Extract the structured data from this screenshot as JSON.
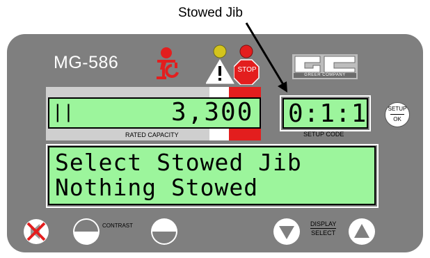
{
  "callout": {
    "label": "Stowed Jib"
  },
  "device": {
    "model": "MG-586",
    "logo_text": "GREER COMPANY",
    "stop_label": "STOP"
  },
  "rated_capacity": {
    "value": "3,300",
    "label": "RATED CAPACITY",
    "bar_indicator": "||"
  },
  "setup_code": {
    "value": "0:1:1",
    "label": "SETUP CODE"
  },
  "main_display": {
    "line1": "Select Stowed Jib",
    "line2": "Nothing Stowed"
  },
  "buttons": {
    "setup_ok_top": "SETUP",
    "setup_ok_bottom": "OK",
    "contrast_label": "CONTRAST",
    "display_label": "DISPLAY",
    "select_label": "SELECT"
  },
  "colors": {
    "panel": "#7f7f7f",
    "lcd_green": "#9cf59c",
    "stop_red": "#e31e1e",
    "warning_yellow": "#d4c41c"
  }
}
